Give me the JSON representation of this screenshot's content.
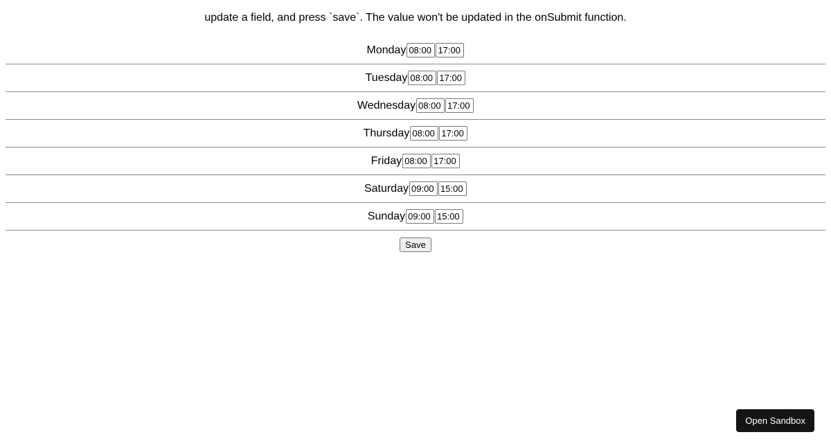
{
  "instruction_text": "update a field, and press `save`. The value won't be updated in the onSubmit function.",
  "days": [
    {
      "label": "Monday",
      "start": "08:00",
      "end": "17:00"
    },
    {
      "label": "Tuesday",
      "start": "08:00",
      "end": "17:00"
    },
    {
      "label": "Wednesday",
      "start": "08:00",
      "end": "17:00"
    },
    {
      "label": "Thursday",
      "start": "08:00",
      "end": "17:00"
    },
    {
      "label": "Friday",
      "start": "08:00",
      "end": "17:00"
    },
    {
      "label": "Saturday",
      "start": "09:00",
      "end": "15:00"
    },
    {
      "label": "Sunday",
      "start": "09:00",
      "end": "15:00"
    }
  ],
  "save_label": "Save",
  "open_sandbox_label": "Open Sandbox"
}
